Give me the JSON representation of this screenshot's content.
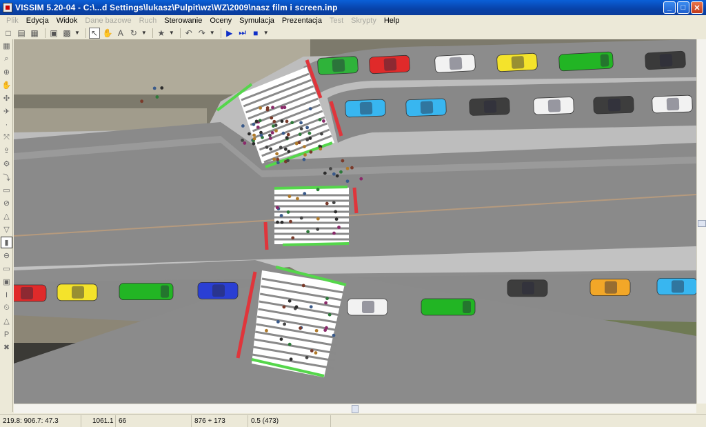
{
  "window": {
    "title": "VISSIM 5.20-04 - C:\\...d Settings\\lukasz\\Pulpit\\wz\\WZ\\2009\\nasz film i screen.inp",
    "minimize": "_",
    "maximize": "□",
    "close": "✕"
  },
  "menu": {
    "items": [
      {
        "label": "Plik",
        "enabled": false
      },
      {
        "label": "Edycja",
        "enabled": true
      },
      {
        "label": "Widok",
        "enabled": true
      },
      {
        "label": "Dane bazowe",
        "enabled": false
      },
      {
        "label": "Ruch",
        "enabled": false
      },
      {
        "label": "Sterowanie",
        "enabled": true
      },
      {
        "label": "Oceny",
        "enabled": true
      },
      {
        "label": "Symulacja",
        "enabled": true
      },
      {
        "label": "Prezentacja",
        "enabled": true
      },
      {
        "label": "Test",
        "enabled": false
      },
      {
        "label": "Skrypty",
        "enabled": false
      },
      {
        "label": "Help",
        "enabled": true
      }
    ]
  },
  "toolbar": {
    "icons": [
      "new-file-icon",
      "open-file-icon",
      "save-icon",
      "print-preview-icon",
      "print-icon",
      "select-arrow-icon",
      "pan-icon",
      "text-size-icon",
      "rotate-icon",
      "pedestrian-icon",
      "undo-icon",
      "redo-icon",
      "play-icon",
      "step-icon",
      "stop-icon"
    ]
  },
  "left_tools": {
    "icons": [
      "network-view-icon",
      "zoom-icon",
      "zoom-in-icon",
      "hand-icon",
      "compass-icon",
      "airplane-icon",
      "link-icon",
      "connector-icon",
      "vehicle-icon",
      "route-icon",
      "speed-icon",
      "warning-icon",
      "yield-icon",
      "signal-head-icon",
      "detector-icon",
      "traffic-light-icon",
      "stop-sign-icon",
      "bus-stop-icon",
      "parking-icon",
      "node-icon",
      "timer-icon",
      "data-collection-icon",
      "parking-lot-icon",
      "close-tool-icon"
    ],
    "selected_index": 15
  },
  "status": {
    "coordinates": "219.8: 906.7: 47.3",
    "simulation_time": "1061.1",
    "speed": "66",
    "vehicles_pedestrians": "876 + 173",
    "time_step": "0.5  (473)"
  },
  "colors": {
    "road": "#8a8a8a",
    "sidewalk": "#bcbcbc",
    "signal_red": "#e0353b",
    "signal_green": "#55d64b",
    "crosswalk_white": "#ffffff"
  },
  "vehicles": [
    {
      "lane": "top-1",
      "color": "#2fb33a",
      "type": "car"
    },
    {
      "lane": "top-1",
      "color": "#e02a2a",
      "type": "car"
    },
    {
      "lane": "top-1",
      "color": "#f2f2f2",
      "type": "car"
    },
    {
      "lane": "top-1",
      "color": "#f4e32b",
      "type": "car"
    },
    {
      "lane": "top-1",
      "color": "#22b524",
      "type": "van"
    },
    {
      "lane": "top-1",
      "color": "#3a3a3a",
      "type": "car"
    },
    {
      "lane": "top-2",
      "color": "#38b6f0",
      "type": "car"
    },
    {
      "lane": "top-2",
      "color": "#38b6f0",
      "type": "car"
    },
    {
      "lane": "top-2",
      "color": "#3d3d3d",
      "type": "car"
    },
    {
      "lane": "top-2",
      "color": "#f2f2f2",
      "type": "car"
    },
    {
      "lane": "top-2",
      "color": "#3d3d3d",
      "type": "car"
    },
    {
      "lane": "top-2",
      "color": "#f2f2f2",
      "type": "car"
    },
    {
      "lane": "bottom",
      "color": "#e02a2a",
      "type": "car"
    },
    {
      "lane": "bottom",
      "color": "#f4e32b",
      "type": "car"
    },
    {
      "lane": "bottom",
      "color": "#22b524",
      "type": "van"
    },
    {
      "lane": "bottom",
      "color": "#2a3fd4",
      "type": "car"
    },
    {
      "lane": "bottom",
      "color": "#f2f2f2",
      "type": "car"
    },
    {
      "lane": "bottom",
      "color": "#22b524",
      "type": "van"
    },
    {
      "lane": "bottom",
      "color": "#3d3d3d",
      "type": "car"
    },
    {
      "lane": "bottom",
      "color": "#f2a728",
      "type": "car"
    },
    {
      "lane": "bottom",
      "color": "#38b6f0",
      "type": "car"
    }
  ]
}
